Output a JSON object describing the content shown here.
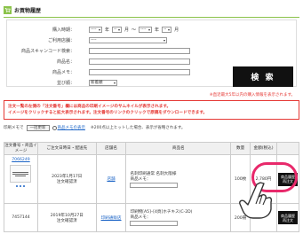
{
  "title": "お買物履歴",
  "form": {
    "purchase_date": {
      "label": "購入時期：",
      "from_year": "----",
      "from_month": "--",
      "to_year": "----",
      "to_month": "--",
      "unit_year": "年",
      "unit_month": "月",
      "separator": "〜"
    },
    "store": {
      "label": "ご利用店舗：",
      "value": "----"
    },
    "barcode": {
      "label": "商品スキャンコード検索："
    },
    "product_name": {
      "label": "商品名："
    },
    "memo": {
      "label": "商品メモ："
    },
    "sort": {
      "label": "並び順：",
      "value": "新着順"
    },
    "search_button": "検 索"
  },
  "note_right": "※直近最大5年以内の購入情報を表示されます。",
  "warning": {
    "line1": "注文一覧の左側の「注文番号」欄には商品の印刷イメージのサムネイルが表示されます。",
    "line2": "イメージをクリックすると拡大表示されます。注文番号のリンクのクリックで原稿をダウンロードできます。"
  },
  "toolbar": {
    "prefix": "印刷メモで",
    "button": "一括更新",
    "radio_label": "商品メモの表示",
    "count": "※200点以上ヒットした場合、表示が省略されます。"
  },
  "table": {
    "headers": [
      "注文番号・商品イメージ",
      "ご注文日時日・配送先",
      "店舗名",
      "商品名",
      "数量",
      "金額(税込)",
      ""
    ],
    "rows": [
      {
        "id": "7066249",
        "date": "2023年1月17日",
        "status": "注文確認済",
        "store": "店舗",
        "product": "名刺印刷通常 名刺大阪様",
        "memo_label": "商品メモ：",
        "qty": "100枚",
        "price": "2,780円",
        "btn1": "商品履歴",
        "btn2": "再注文"
      },
      {
        "id": "7457144",
        "date": "2019年10月27日",
        "status": "注文確認済",
        "store": "印刷通販店",
        "product": "印刷物[A5]–[4頁]ホチキス(C-2D)",
        "memo_label": "商品メモ：",
        "qty": "200冊",
        "price": "",
        "btn1": "商品履歴",
        "btn2": "再注文"
      }
    ]
  },
  "colors": {
    "accent": "#8bc34a",
    "warning": "#e53935",
    "highlight": "#e8296b",
    "link": "#1a63c6"
  }
}
